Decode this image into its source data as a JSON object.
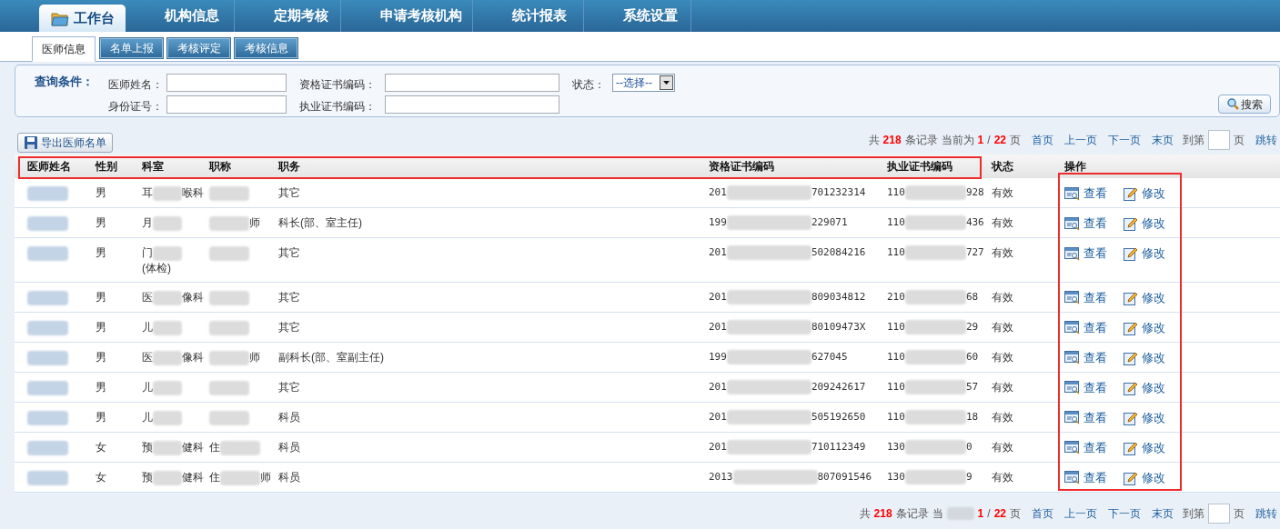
{
  "nav": {
    "items": [
      {
        "label": "工作台",
        "selected": true
      },
      {
        "label": "机构信息",
        "selected": false
      },
      {
        "label": "定期考核",
        "selected": false
      },
      {
        "label": "申请考核机构",
        "selected": false
      },
      {
        "label": "统计报表",
        "selected": false
      },
      {
        "label": "系统设置",
        "selected": false
      }
    ]
  },
  "subtabs": [
    {
      "label": "医师信息",
      "selected": true
    },
    {
      "label": "名单上报",
      "selected": false
    },
    {
      "label": "考核评定",
      "selected": false
    },
    {
      "label": "考核信息",
      "selected": false
    }
  ],
  "query": {
    "title": "查询条件：",
    "fields": [
      {
        "kind": "text",
        "label": "医师姓名："
      },
      {
        "kind": "text",
        "label": "资格证书编码："
      },
      {
        "kind": "select",
        "label": "状态：",
        "value": "--选择--"
      },
      {
        "kind": "text",
        "label": "身份证号："
      },
      {
        "kind": "text",
        "label": "执业证书编码："
      }
    ],
    "search_button": "搜索"
  },
  "export_button": "导出医师名单",
  "pager_top": [
    {
      "kind": "text",
      "text": "共"
    },
    {
      "kind": "num",
      "text": "218"
    },
    {
      "kind": "text",
      "text": "条记录"
    },
    {
      "kind": "text",
      "text": "当前为"
    },
    {
      "kind": "num",
      "text": "1"
    },
    {
      "kind": "text",
      "text": "/"
    },
    {
      "kind": "num",
      "text": "22"
    },
    {
      "kind": "text",
      "text": "页"
    },
    {
      "kind": "link",
      "text": "首页"
    },
    {
      "kind": "link",
      "text": "上一页"
    },
    {
      "kind": "link",
      "text": "下一页"
    },
    {
      "kind": "link",
      "text": "末页"
    },
    {
      "kind": "text",
      "text": "到第"
    },
    {
      "kind": "field"
    },
    {
      "kind": "text",
      "text": "页"
    },
    {
      "kind": "link",
      "text": "跳转"
    }
  ],
  "table": {
    "columns": [
      "医师姓名",
      "性别",
      "科室",
      "职称",
      "职务",
      "资格证书编码",
      "执业证书编码",
      "状态",
      "操作"
    ],
    "rows": [
      {
        "sex": "男",
        "dept": {
          "start": "耳",
          "end": "喉科"
        },
        "title": {},
        "duty": "其它",
        "qual": {
          "start": "201",
          "end": "701232314"
        },
        "prac": {
          "start": "110",
          "end": "928"
        },
        "status": "有效",
        "actions": [
          {
            "kind": "view",
            "label": "查看"
          },
          {
            "kind": "edit",
            "label": "修改"
          }
        ]
      },
      {
        "sex": "男",
        "dept": {
          "start": "月"
        },
        "title": {
          "end": "师"
        },
        "duty": "科长(部、室主任)",
        "qual": {
          "start": "199",
          "end": "229071"
        },
        "prac": {
          "start": "110",
          "end": "436"
        },
        "status": "有效",
        "actions": [
          {
            "kind": "view",
            "label": "查看"
          },
          {
            "kind": "edit",
            "label": "修改"
          }
        ]
      },
      {
        "sex": "男",
        "dept": {
          "start": "门",
          "end": "(体检)"
        },
        "title": {},
        "duty": "其它",
        "qual": {
          "start": "201",
          "end": "502084216"
        },
        "prac": {
          "start": "110",
          "end": "727"
        },
        "status": "有效",
        "actions": [
          {
            "kind": "view",
            "label": "查看"
          },
          {
            "kind": "edit",
            "label": "修改"
          }
        ]
      },
      {
        "sex": "男",
        "dept": {
          "start": "医",
          "end": "像科"
        },
        "title": {},
        "duty": "其它",
        "qual": {
          "start": "201",
          "end": "809034812"
        },
        "prac": {
          "start": "210",
          "end": "68"
        },
        "status": "有效",
        "actions": [
          {
            "kind": "view",
            "label": "查看"
          },
          {
            "kind": "edit",
            "label": "修改"
          }
        ]
      },
      {
        "sex": "男",
        "dept": {
          "start": "儿"
        },
        "title": {},
        "duty": "其它",
        "qual": {
          "start": "201",
          "end": "80109473X"
        },
        "prac": {
          "start": "110",
          "end": "29"
        },
        "status": "有效",
        "actions": [
          {
            "kind": "view",
            "label": "查看"
          },
          {
            "kind": "edit",
            "label": "修改"
          }
        ]
      },
      {
        "sex": "男",
        "dept": {
          "start": "医",
          "end": "像科"
        },
        "title": {
          "end": "师"
        },
        "duty": "副科长(部、室副主任)",
        "qual": {
          "start": "199",
          "end": "627045"
        },
        "prac": {
          "start": "110",
          "end": "60"
        },
        "status": "有效",
        "actions": [
          {
            "kind": "view",
            "label": "查看"
          },
          {
            "kind": "edit",
            "label": "修改"
          }
        ]
      },
      {
        "sex": "男",
        "dept": {
          "start": "儿"
        },
        "title": {},
        "duty": "其它",
        "qual": {
          "start": "201",
          "end": "209242617"
        },
        "prac": {
          "start": "110",
          "end": "57"
        },
        "status": "有效",
        "actions": [
          {
            "kind": "view",
            "label": "查看"
          },
          {
            "kind": "edit",
            "label": "修改"
          }
        ]
      },
      {
        "sex": "男",
        "dept": {
          "start": "儿"
        },
        "title": {},
        "duty": "科员",
        "qual": {
          "start": "201",
          "end": "505192650"
        },
        "prac": {
          "start": "110",
          "end": "18"
        },
        "status": "有效",
        "actions": [
          {
            "kind": "view",
            "label": "查看"
          },
          {
            "kind": "edit",
            "label": "修改"
          }
        ]
      },
      {
        "sex": "女",
        "dept": {
          "start": "预",
          "end": "健科"
        },
        "title": {
          "start": "住"
        },
        "duty": "科员",
        "qual": {
          "start": "201",
          "end": "710112349"
        },
        "prac": {
          "start": "130",
          "end": "0"
        },
        "status": "有效",
        "actions": [
          {
            "kind": "view",
            "label": "查看"
          },
          {
            "kind": "edit",
            "label": "修改"
          }
        ]
      },
      {
        "sex": "女",
        "dept": {
          "start": "预",
          "end": "健科"
        },
        "title": {
          "start": "住",
          "end": "师"
        },
        "duty": "科员",
        "qual": {
          "start": "2013",
          "end": "807091546"
        },
        "prac": {
          "start": "130",
          "end": "9"
        },
        "status": "有效",
        "actions": [
          {
            "kind": "view",
            "label": "查看"
          },
          {
            "kind": "edit",
            "label": "修改"
          }
        ]
      }
    ]
  },
  "pager_bottom": [
    {
      "kind": "text",
      "text": "共"
    },
    {
      "kind": "num",
      "text": "218"
    },
    {
      "kind": "text",
      "text": "条记录"
    },
    {
      "kind": "text",
      "text": "当"
    },
    {
      "kind": "mask"
    },
    {
      "kind": "num",
      "text": "1"
    },
    {
      "kind": "text",
      "text": "/"
    },
    {
      "kind": "num",
      "text": "22"
    },
    {
      "kind": "text",
      "text": "页"
    },
    {
      "kind": "link",
      "text": "首页"
    },
    {
      "kind": "link",
      "text": "上一页"
    },
    {
      "kind": "link",
      "text": "下一页"
    },
    {
      "kind": "link",
      "text": "末页"
    },
    {
      "kind": "text",
      "text": "到第"
    },
    {
      "kind": "field"
    },
    {
      "kind": "text",
      "text": "页"
    },
    {
      "kind": "link",
      "text": "跳转"
    }
  ]
}
